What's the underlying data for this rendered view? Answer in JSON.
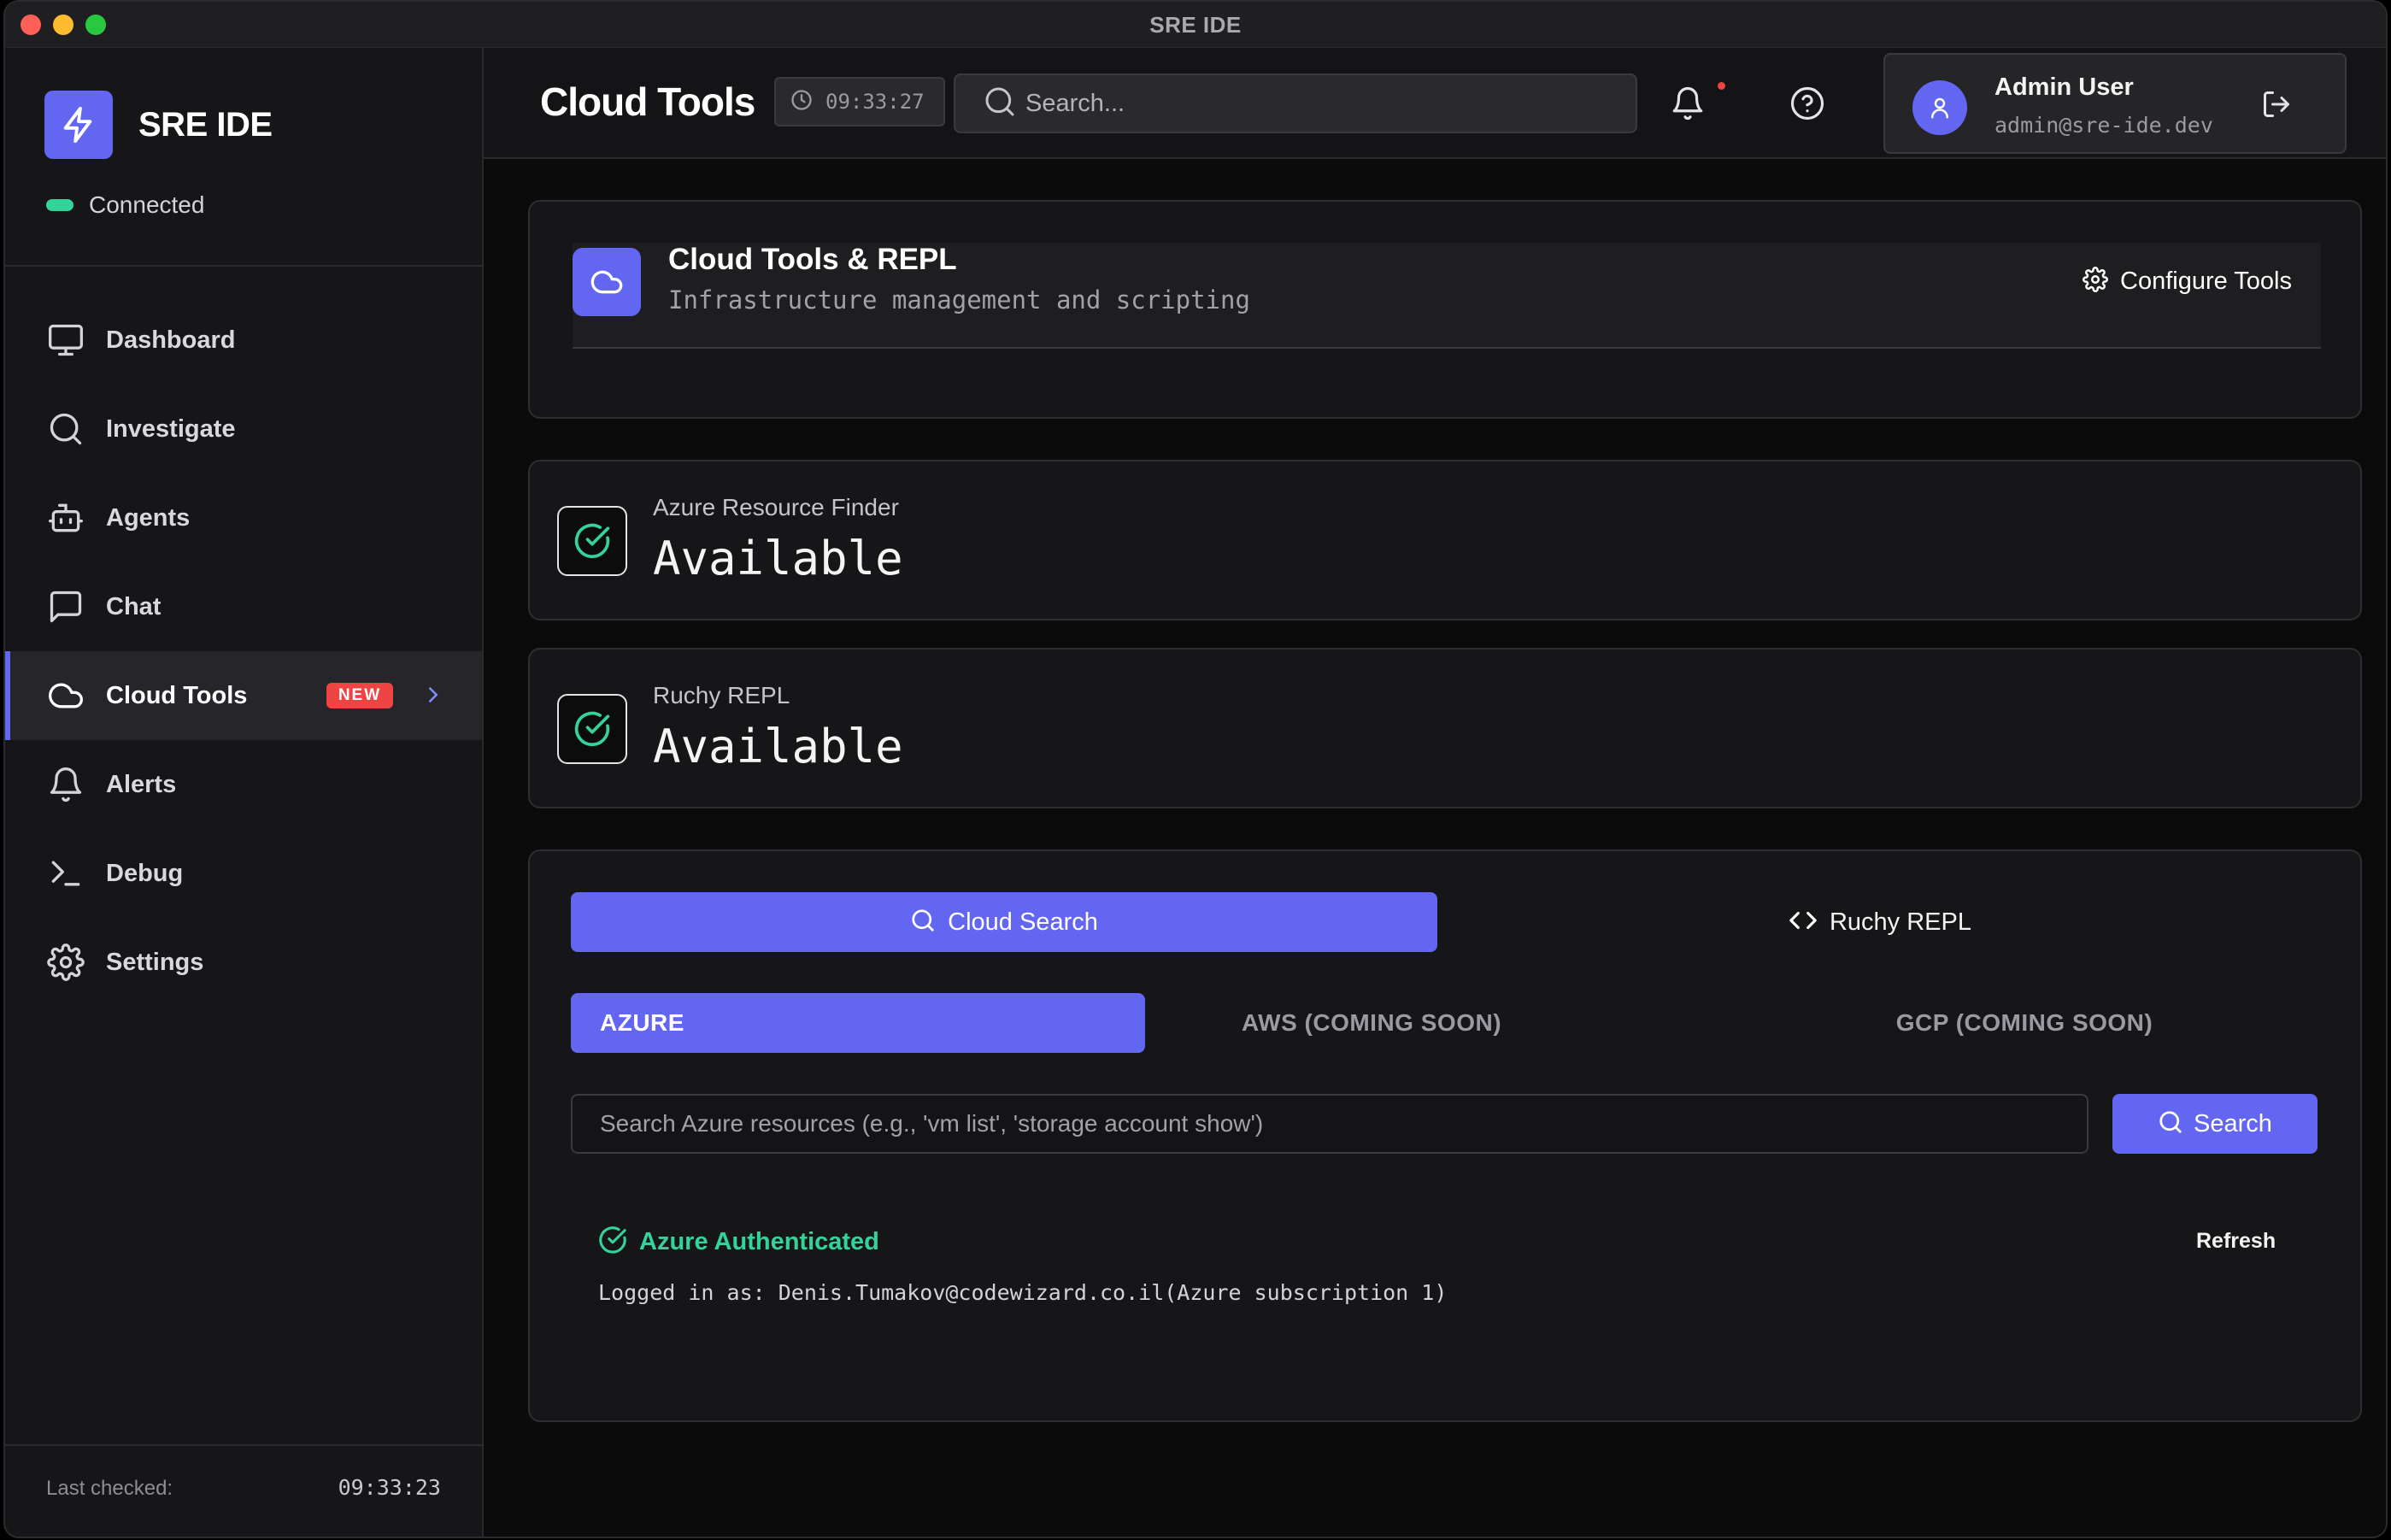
{
  "window": {
    "title": "SRE IDE"
  },
  "sidebar": {
    "brand": "SRE IDE",
    "connection_status": "Connected",
    "nav": [
      {
        "label": "Dashboard",
        "icon": "monitor-icon"
      },
      {
        "label": "Investigate",
        "icon": "search-icon"
      },
      {
        "label": "Agents",
        "icon": "bot-icon"
      },
      {
        "label": "Chat",
        "icon": "chat-icon"
      },
      {
        "label": "Cloud Tools",
        "icon": "cloud-icon",
        "active": true,
        "badge": "NEW"
      },
      {
        "label": "Alerts",
        "icon": "bell-icon"
      },
      {
        "label": "Debug",
        "icon": "terminal-icon"
      },
      {
        "label": "Settings",
        "icon": "gear-icon"
      }
    ],
    "last_checked_label": "Last checked:",
    "last_checked_time": "09:33:23"
  },
  "header": {
    "title": "Cloud Tools",
    "clock": "09:33:27",
    "search_placeholder": "Search...",
    "user": {
      "name": "Admin User",
      "email": "admin@sre-ide.dev"
    }
  },
  "hero": {
    "title": "Cloud Tools & REPL",
    "subtitle": "Infrastructure management and scripting",
    "configure_label": "Configure Tools"
  },
  "status_cards": [
    {
      "name": "Azure Resource Finder",
      "value": "Available"
    },
    {
      "name": "Ruchy REPL",
      "value": "Available"
    }
  ],
  "tools": {
    "tabs": {
      "cloud_search": "Cloud Search",
      "ruchy_repl": "Ruchy REPL"
    },
    "providers": {
      "azure": "AZURE",
      "aws": "AWS (COMING SOON)",
      "gcp": "GCP (COMING SOON)"
    },
    "search_placeholder": "Search Azure resources (e.g., 'vm list', 'storage account show')",
    "search_button": "Search",
    "auth_status": "Azure Authenticated",
    "refresh_label": "Refresh",
    "logged_in_text": "Logged in as: Denis.Tumakov@codewizard.co.il(Azure subscription 1)"
  },
  "colors": {
    "accent": "#6366f1",
    "success": "#34d399",
    "badge": "#ef4444"
  }
}
